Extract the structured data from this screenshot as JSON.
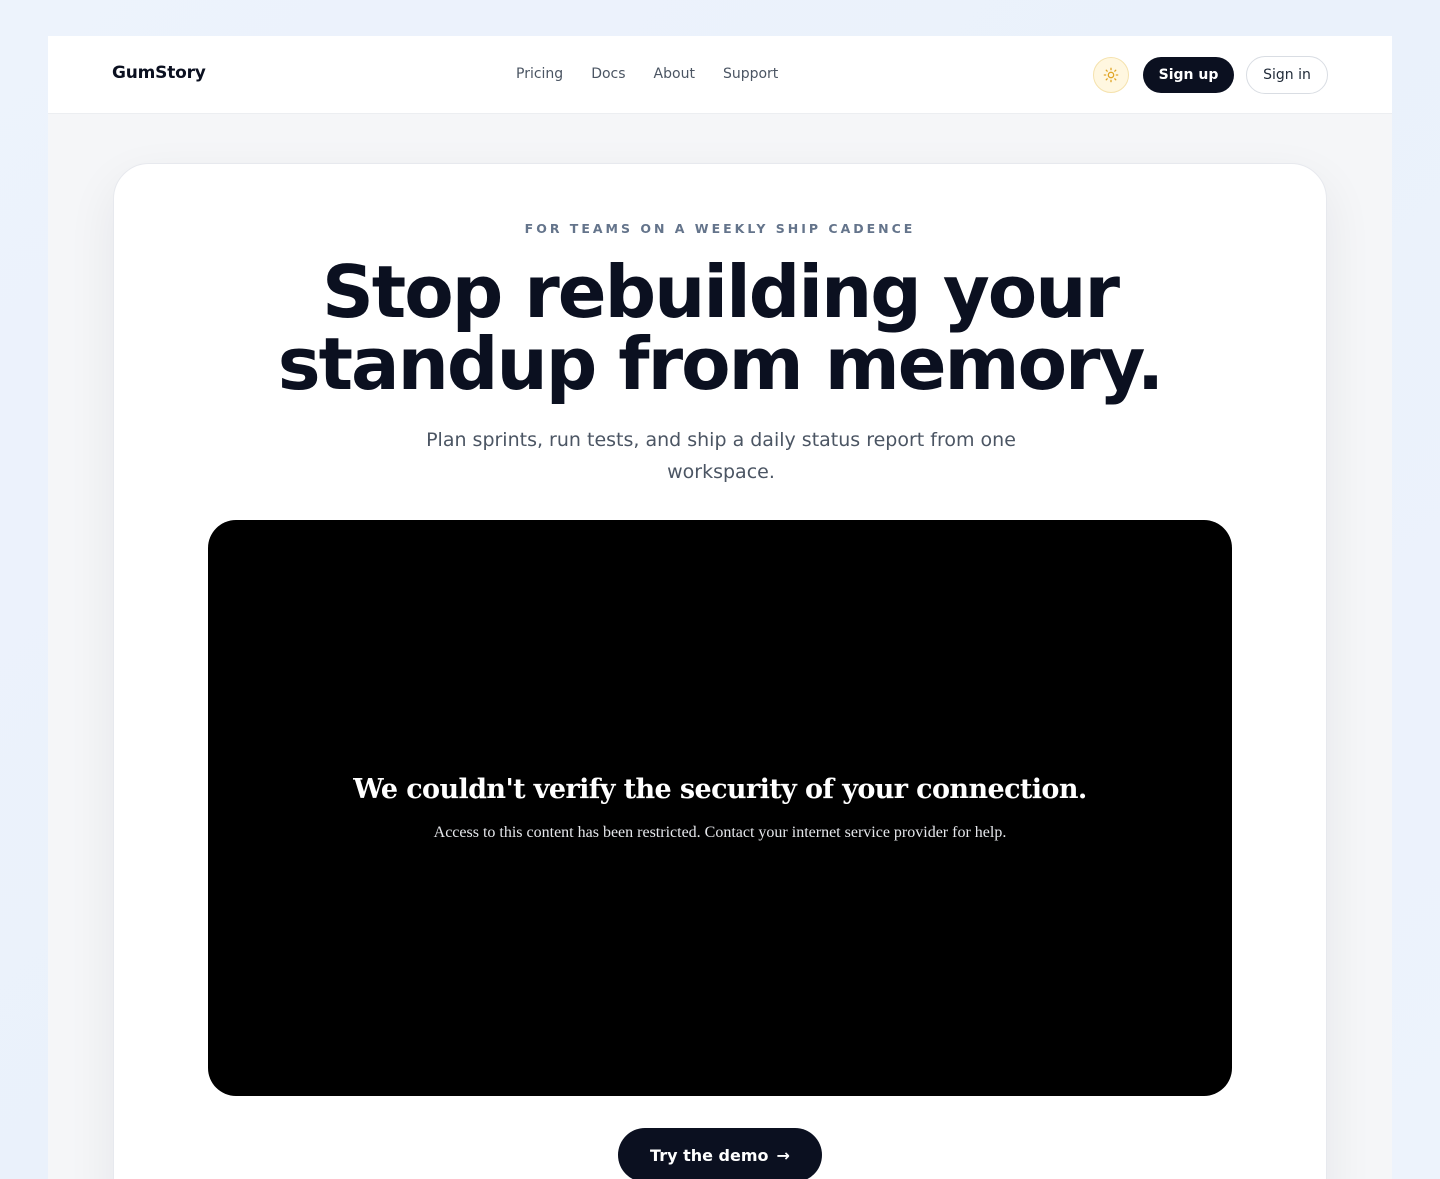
{
  "header": {
    "brand": "GumStory",
    "nav": [
      {
        "label": "Pricing"
      },
      {
        "label": "Docs"
      },
      {
        "label": "About"
      },
      {
        "label": "Support"
      }
    ],
    "theme_icon": "sun-icon",
    "signup_label": "Sign up",
    "signin_label": "Sign in"
  },
  "hero": {
    "eyebrow": "FOR TEAMS ON A WEEKLY SHIP CADENCE",
    "headline_line1": "Stop rebuilding your",
    "headline_line2": "standup from memory.",
    "subhead": "Plan sprints, run tests, and ship a daily status report from one workspace."
  },
  "video": {
    "title": "We couldn't verify the security of your connection.",
    "message": "Access to this content has been restricted. Contact your internet service provider for help."
  },
  "cta": {
    "label": "Try the demo",
    "arrow": "→"
  },
  "colors": {
    "primary": "#0b1020",
    "accent_sun": "#e0a526",
    "background": "#f5f6f8"
  }
}
